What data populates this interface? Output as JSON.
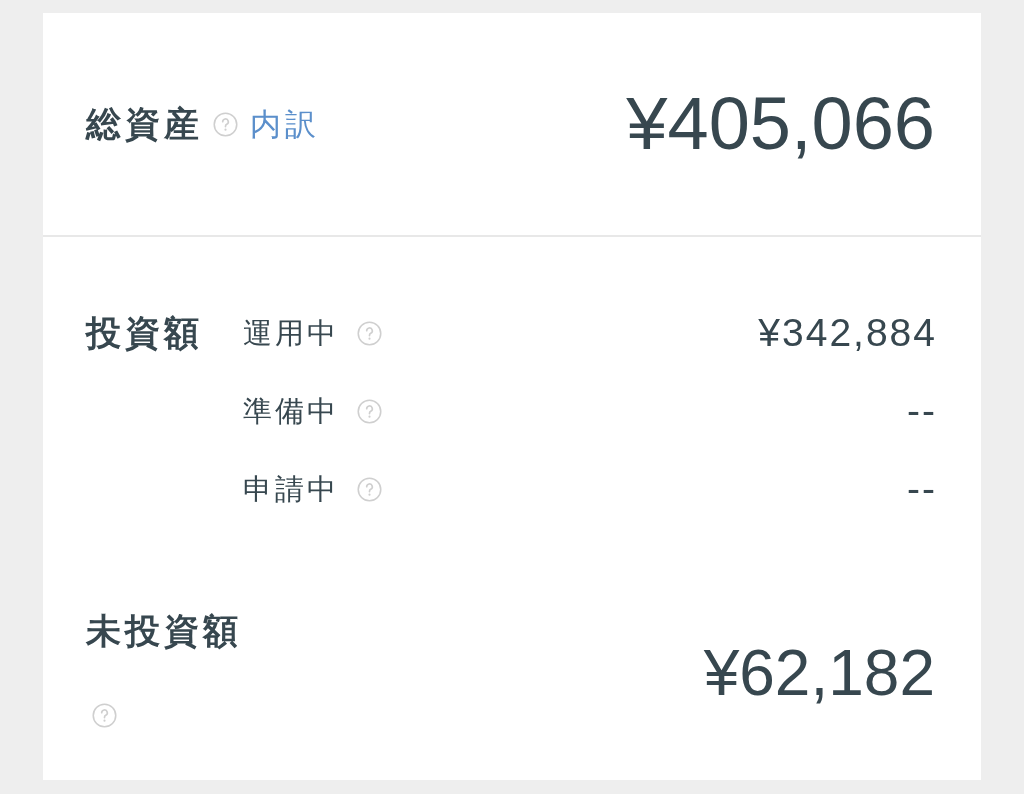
{
  "total_assets": {
    "label": "総資産",
    "breakdown_link": "内訳",
    "amount": "¥405,066"
  },
  "invested": {
    "label": "投資額",
    "rows": [
      {
        "label": "運用中",
        "value": "¥342,884"
      },
      {
        "label": "準備中",
        "value": "--"
      },
      {
        "label": "申請中",
        "value": "--"
      }
    ]
  },
  "uninvested": {
    "label": "未投資額",
    "amount": "¥62,182"
  }
}
